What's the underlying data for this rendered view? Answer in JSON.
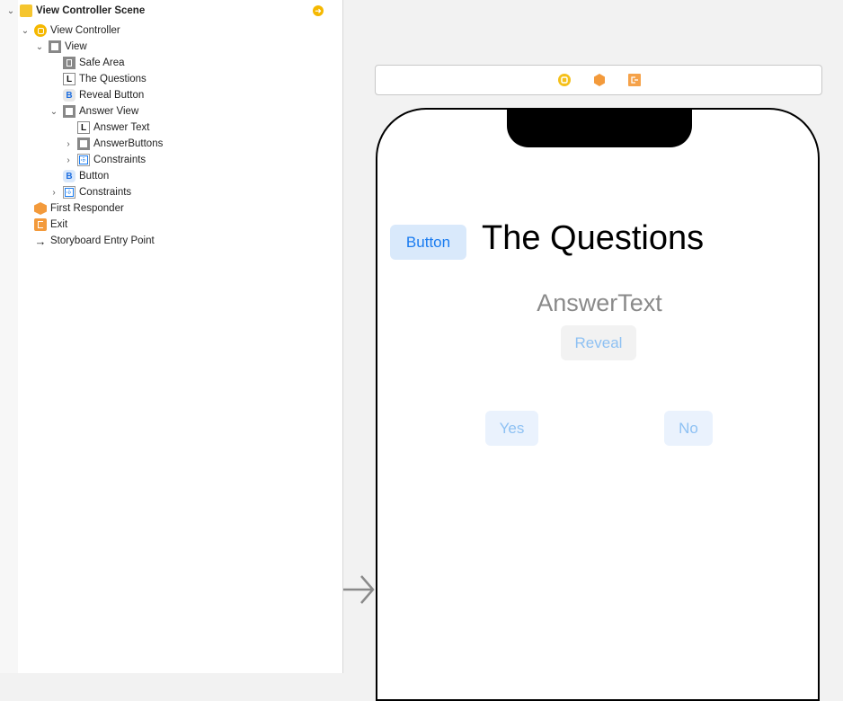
{
  "outline": {
    "scene": {
      "label": "View Controller Scene",
      "icon": "scene-icon"
    },
    "items": [
      {
        "label": "View Controller",
        "icon": "view-controller-icon",
        "expanded": true
      },
      {
        "label": "View",
        "icon": "view-icon",
        "expanded": true
      },
      {
        "label": "Safe Area",
        "icon": "safe-area-icon"
      },
      {
        "label": "The Questions",
        "icon": "label-icon",
        "glyph": "L"
      },
      {
        "label": "Reveal Button",
        "icon": "button-icon",
        "glyph": "B"
      },
      {
        "label": "Answer View",
        "icon": "view-icon",
        "expanded": true
      },
      {
        "label": "Answer Text",
        "icon": "label-icon",
        "glyph": "L"
      },
      {
        "label": "AnswerButtons",
        "icon": "view-icon",
        "expanded": false
      },
      {
        "label": "Constraints",
        "icon": "constraints-icon",
        "expanded": false
      },
      {
        "label": "Button",
        "icon": "button-icon",
        "glyph": "B"
      },
      {
        "label": "Constraints",
        "icon": "constraints-icon",
        "expanded": false
      },
      {
        "label": "First Responder",
        "icon": "first-responder-icon"
      },
      {
        "label": "Exit",
        "icon": "exit-icon"
      },
      {
        "label": "Storyboard Entry Point",
        "icon": "entry-arrow-icon",
        "glyph": "→"
      }
    ]
  },
  "canvas": {
    "button_label": "Button",
    "title_label": "The Questions",
    "answer_text": "AnswerText",
    "reveal_label": "Reveal",
    "yes_label": "Yes",
    "no_label": "No"
  },
  "colors": {
    "accent": "#1a7cf0",
    "scene_yellow": "#f5b800",
    "orange": "#f39a3b"
  }
}
